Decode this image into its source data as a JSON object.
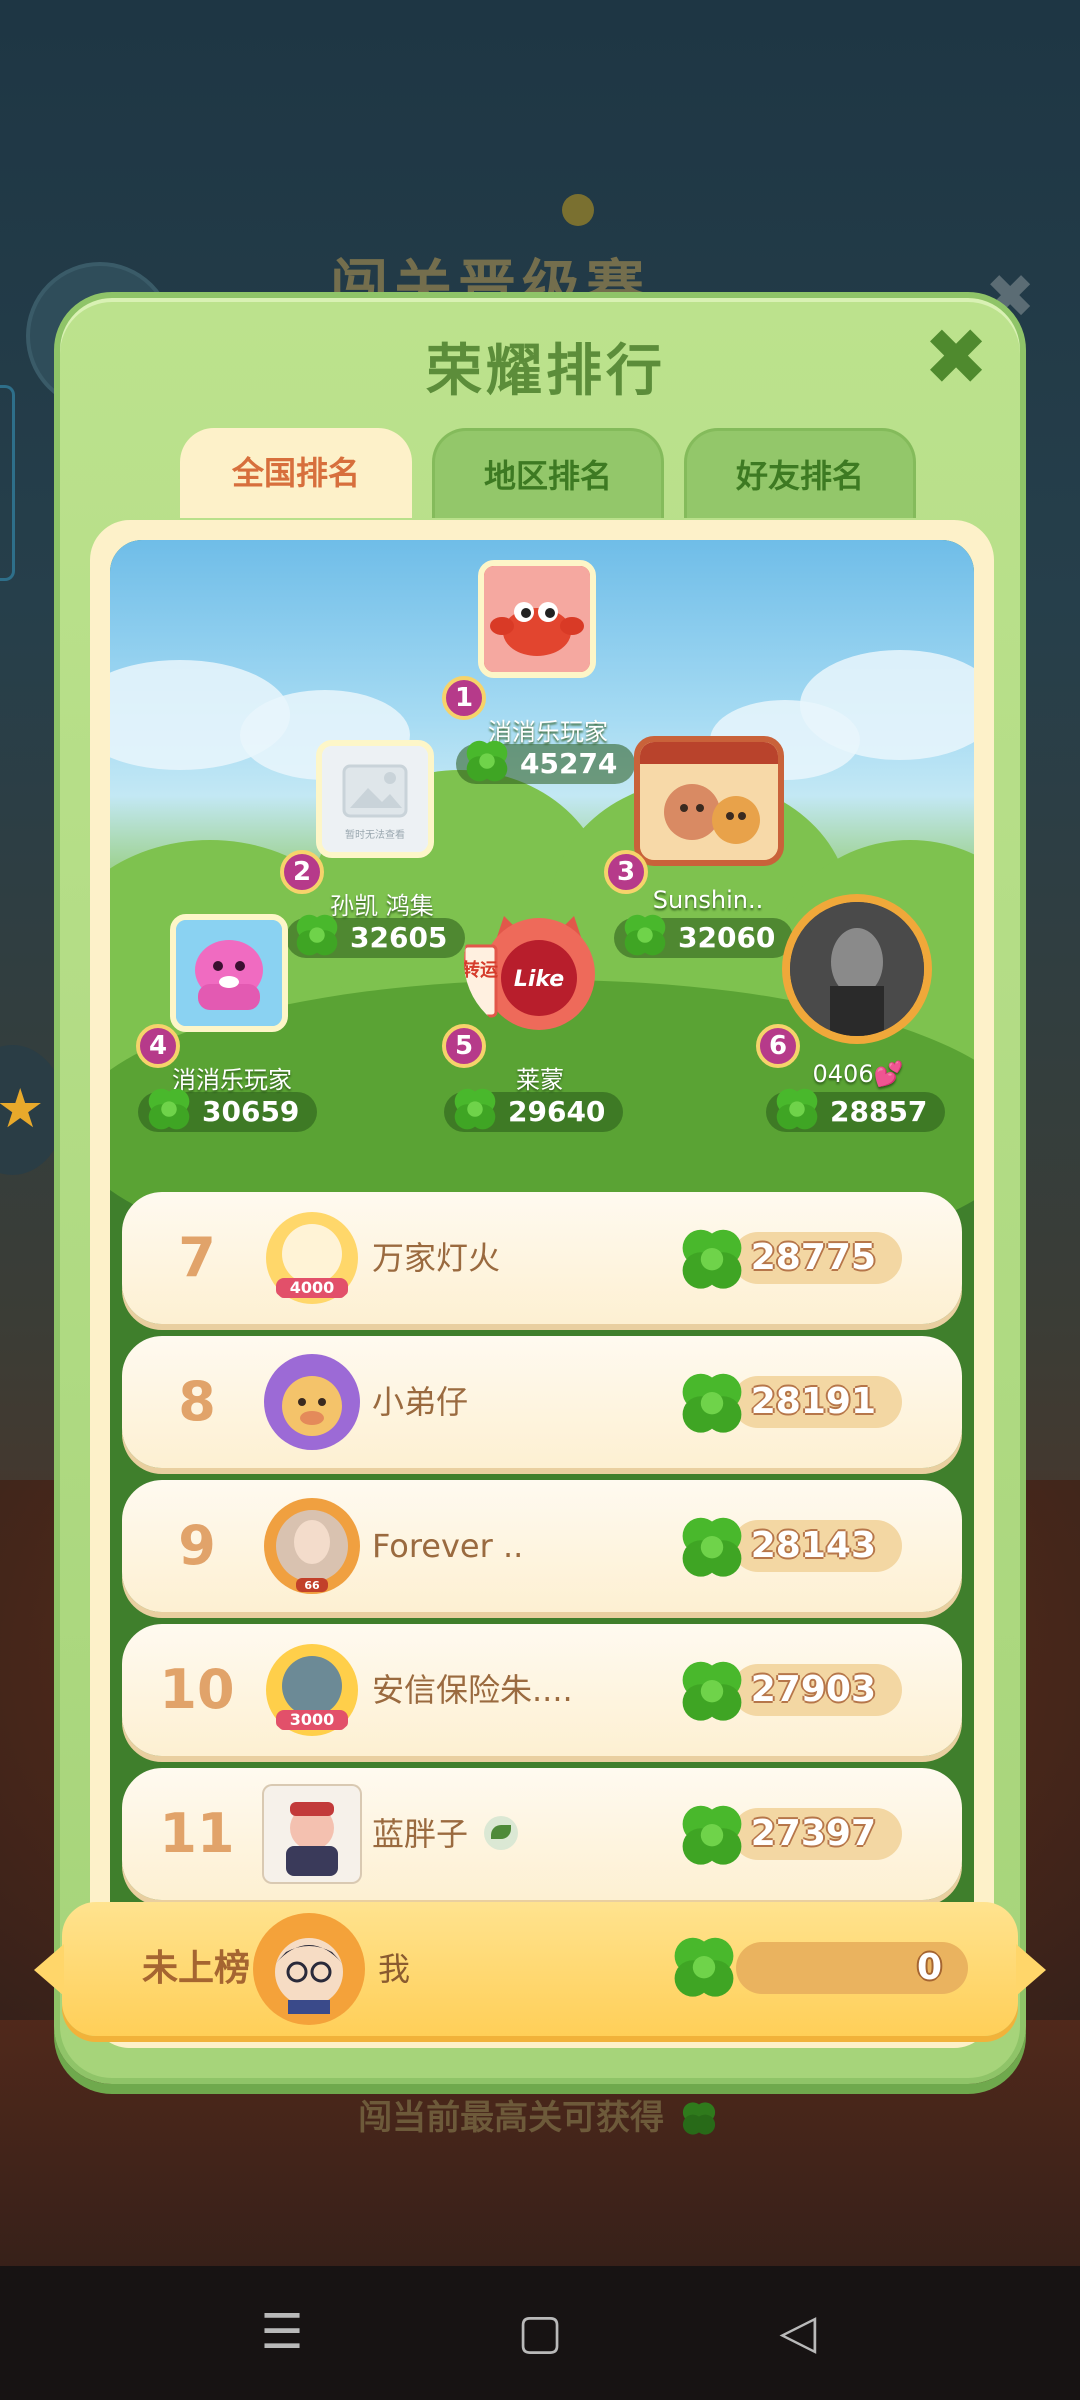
{
  "background": {
    "title": "闯关晋级赛",
    "hint_text": "闯当前最高关可获得"
  },
  "panel": {
    "title": "荣耀排行",
    "tabs": [
      {
        "label": "全国排名",
        "active": true
      },
      {
        "label": "地区排名",
        "active": false
      },
      {
        "label": "好友排名",
        "active": false
      }
    ]
  },
  "podium": [
    {
      "rank": "1",
      "name": "消消乐玩家",
      "score": "45274",
      "avatar_icon": "crab-avatar-icon"
    },
    {
      "rank": "2",
      "name": "孙凯 鸿集",
      "score": "32605",
      "avatar_icon": "placeholder-image-icon",
      "avatar_caption": "暂时无法查看"
    },
    {
      "rank": "3",
      "name": "Sunshin..",
      "score": "32060",
      "avatar_icon": "bear-house-icon"
    },
    {
      "rank": "4",
      "name": "消消乐玩家",
      "score": "30659",
      "avatar_icon": "octopus-avatar-icon"
    },
    {
      "rank": "5",
      "name": "莱蒙",
      "score": "29640",
      "avatar_icon": "lucky-cat-avatar-icon",
      "avatar_label": "转运",
      "avatar_badge": "Like"
    },
    {
      "rank": "6",
      "name": "0406💕",
      "score": "28857",
      "avatar_icon": "portrait-avatar-icon"
    }
  ],
  "rows": [
    {
      "rank": "7",
      "name": "万家灯火",
      "score": "28775",
      "frame_badge": "4000"
    },
    {
      "rank": "8",
      "name": "小弟仔",
      "score": "28191"
    },
    {
      "rank": "9",
      "name": "Forever ..",
      "score": "28143",
      "frame_badge": "66"
    },
    {
      "rank": "10",
      "name": "安信保险朱....",
      "score": "27903",
      "frame_badge": "3000"
    },
    {
      "rank": "11",
      "name": "蓝胖子",
      "score": "27397"
    }
  ],
  "me": {
    "rank_text": "未上榜",
    "name": "我",
    "score": "0"
  },
  "colors": {
    "panel_green": "#a6d47a",
    "title_green": "#5c8d3a",
    "tab_active_bg": "#fdf1c9",
    "tab_active_text": "#d76f3c",
    "rank_badge": "#b63a8a",
    "row_bg": "#fdf0d2",
    "me_bar": "#ffcf58"
  }
}
